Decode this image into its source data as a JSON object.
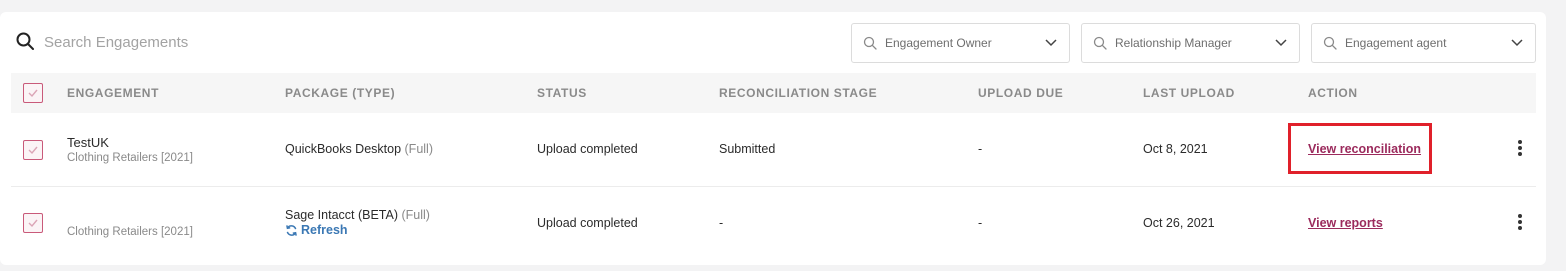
{
  "search": {
    "placeholder": "Search Engagements"
  },
  "filters": [
    {
      "label": "Engagement Owner"
    },
    {
      "label": "Relationship Manager"
    },
    {
      "label": "Engagement agent"
    }
  ],
  "table": {
    "columns": [
      "ENGAGEMENT",
      "PACKAGE (TYPE)",
      "STATUS",
      "RECONCILIATION STAGE",
      "UPLOAD DUE",
      "LAST UPLOAD",
      "ACTION"
    ],
    "rows": [
      {
        "name": "TestUK",
        "client": "Clothing Retailers [2021]",
        "package": "QuickBooks Desktop",
        "package_type": "(Full)",
        "status": "Upload completed",
        "stage": "Submitted",
        "upload_due": "-",
        "last_upload": "Oct 8, 2021",
        "action": "View reconciliation"
      },
      {
        "name": "",
        "client": "Clothing Retailers [2021]",
        "package": "Sage Intacct (BETA)",
        "package_type": "(Full)",
        "refresh_label": "Refresh",
        "status": "Upload completed",
        "stage": "-",
        "upload_due": "-",
        "last_upload": "Oct 26, 2021",
        "action": "View reports"
      }
    ]
  },
  "colors": {
    "accent": "#9b2a5c",
    "checkbox": "#c95a7a",
    "refresh": "#3b78b4",
    "highlight": "#e0202a"
  }
}
